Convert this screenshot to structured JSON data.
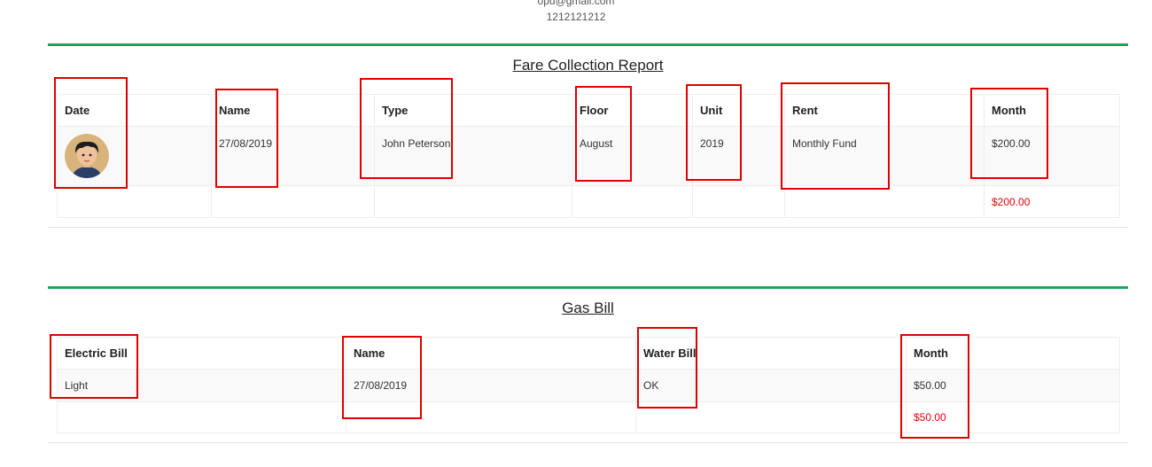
{
  "contact": {
    "email": "opu@gmail.com",
    "phone": "1212121212"
  },
  "fare_section": {
    "title": "Fare Collection Report",
    "headers": [
      "Date",
      "Name",
      "Type",
      "Floor",
      "Unit",
      "Rent",
      "Month"
    ],
    "row": {
      "avatar_icon": "person-avatar-icon",
      "name": "27/08/2019",
      "type": "John Peterson",
      "floor": "August",
      "unit": "2019",
      "rent": "Monthly Fund",
      "month": "$200.00"
    },
    "total": "$200.00"
  },
  "gas_section": {
    "title": "Gas Bill",
    "headers": [
      "Electric Bill",
      "Name",
      "Water Bill",
      "Month"
    ],
    "row": {
      "electric": "Light",
      "name": "27/08/2019",
      "water": "OK",
      "month": "$50.00"
    },
    "total": "$50.00"
  },
  "colors": {
    "accent_green": "#1fa55a",
    "total_red": "#e8000a",
    "highlight_red": "#e10000"
  }
}
